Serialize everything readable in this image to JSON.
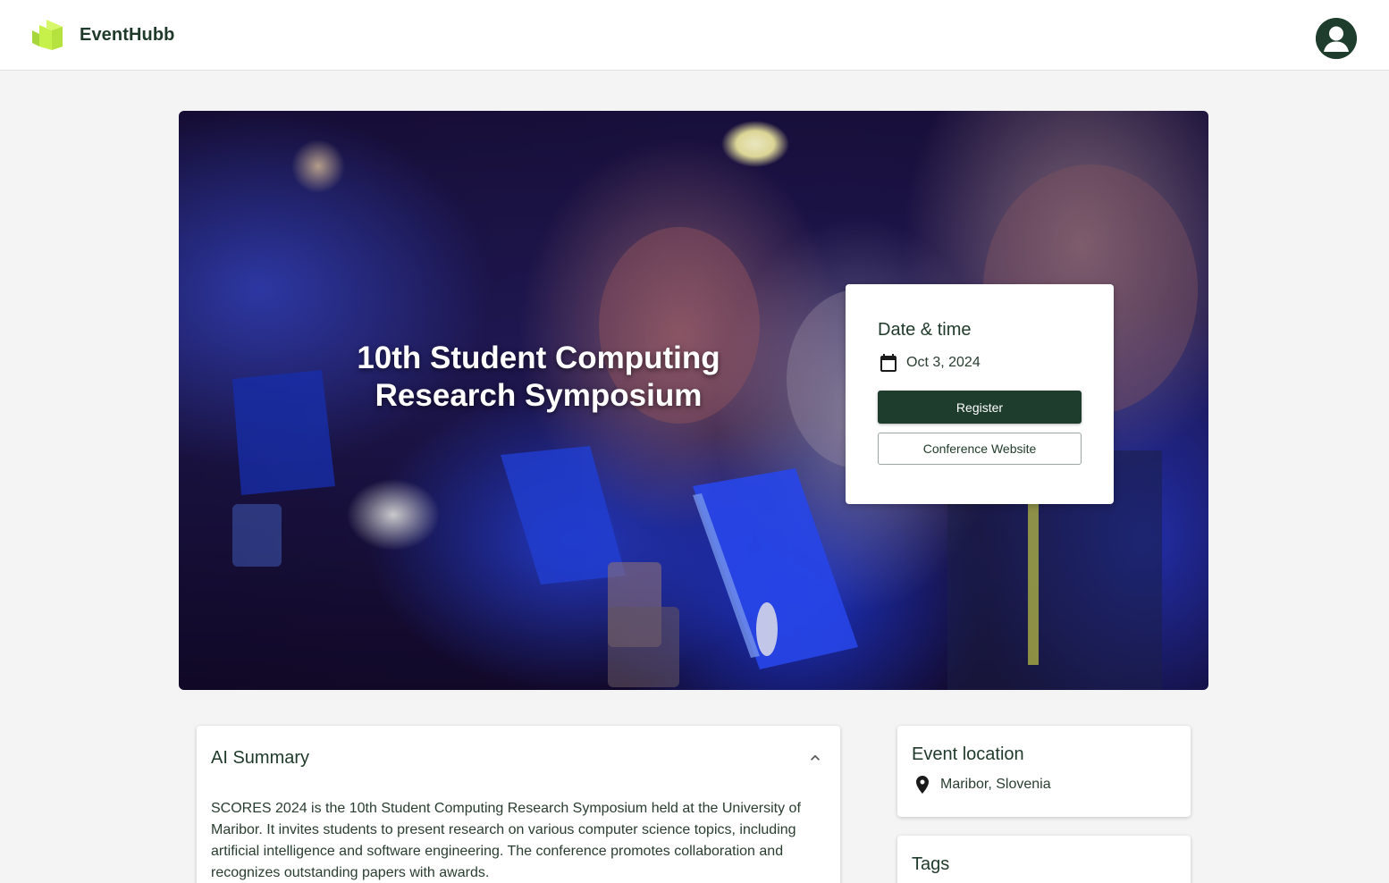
{
  "app": {
    "brand": "EventHubb",
    "brand_color": "#1f3a2a",
    "logo_color": "#c6f04a",
    "logo_icon": "stacked-chevron-logo-icon",
    "avatar_icon": "user-avatar-icon"
  },
  "event": {
    "title": "10th Student Computing Research Symposium"
  },
  "date_card": {
    "heading": "Date & time",
    "icon": "calendar-icon",
    "date": "Oct 3, 2024",
    "register_label": "Register",
    "website_label": "Conference Website"
  },
  "summary": {
    "heading": "AI Summary",
    "toggle_icon": "chevron-up-icon",
    "text": "SCORES 2024 is the 10th Student Computing Research Symposium held at the University of Maribor. It invites students to present research on various computer science topics, including artificial intelligence and software engineering. The conference promotes collaboration and recognizes outstanding papers with awards."
  },
  "location": {
    "heading": "Event location",
    "icon": "location-pin-icon",
    "place": "Maribor, Slovenia"
  },
  "tags": {
    "heading": "Tags"
  },
  "colors": {
    "primary": "#1e3d2d",
    "background": "#f4f4f4"
  }
}
